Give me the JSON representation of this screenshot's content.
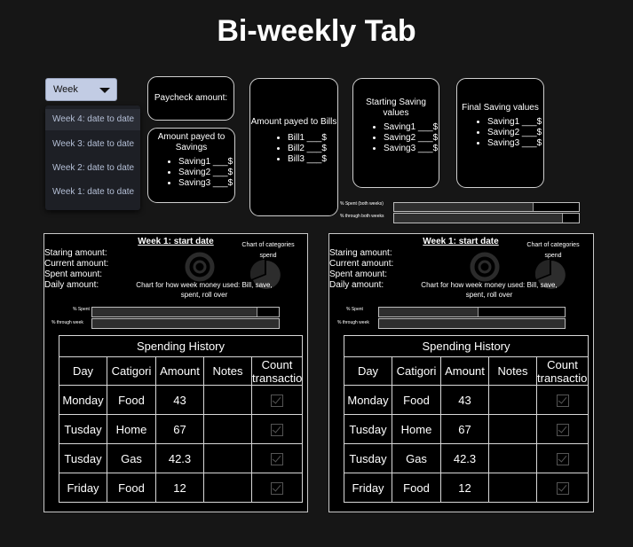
{
  "page": {
    "title": "Bi-weekly Tab"
  },
  "week_select": {
    "value": "Week",
    "options": [
      "Week 4: date to date",
      "Week 3: date to date",
      "Week 2: date to date",
      "Week 1: date to date"
    ]
  },
  "paycheck": {
    "label": "Paycheck amount:"
  },
  "savings_paid": {
    "label": "Amount payed to Savings",
    "items": [
      "Saving1 ___$",
      "Saving2 ___$",
      "Saving3 ___$"
    ]
  },
  "bills": {
    "label": "Amount payed to Bills",
    "items": [
      "Bill1 ___$",
      "Bill2 ___$",
      "Bill3 ___$"
    ]
  },
  "starting_saving": {
    "label": "Starting Saving values",
    "items": [
      "Saving1 ___$",
      "Saving2 ___$",
      "Saving3 ___$"
    ]
  },
  "final_saving": {
    "label": "Final Saving values",
    "items": [
      "Saving1 ___$",
      "Saving2 ___$",
      "Saving3 ___$"
    ]
  },
  "biweekly_bars": {
    "spent_label": "% Spent (both weeks)",
    "spent_fraction": 0.75,
    "through_label": "% through both weeks",
    "through_fraction": 0.91
  },
  "weeks": [
    {
      "title": "Week 1: start date",
      "labels": [
        "Staring amount:",
        "Current amount:",
        "Spent amount:",
        "Daily amount:"
      ],
      "categories_chart_label": "Chart of categories spend",
      "usage_chart_label": "Chart for how week money used: Bill, save, spent, roll over",
      "spent_label": "% Spent",
      "spent_fraction": 0.88,
      "through_label": "% through week",
      "through_fraction": 1.0,
      "history": {
        "title": "Spending History",
        "columns": [
          "Day",
          "Catigori",
          "Amount",
          "Notes",
          "Count transaction"
        ],
        "rows": [
          {
            "day": "Monday",
            "category": "Food",
            "amount": "43",
            "notes": ""
          },
          {
            "day": "Tusday",
            "category": "Home",
            "amount": "67",
            "notes": ""
          },
          {
            "day": "Tusday",
            "category": "Gas",
            "amount": "42.3",
            "notes": ""
          },
          {
            "day": "Friday",
            "category": "Food",
            "amount": "12",
            "notes": ""
          }
        ]
      }
    },
    {
      "title": "Week 1: start date",
      "labels": [
        "Staring amount:",
        "Current amount:",
        "Spent amount:",
        "Daily amount:"
      ],
      "categories_chart_label": "Chart of categories spend",
      "usage_chart_label": "Chart for how week money used: Bill, save, spent, roll over",
      "spent_label": "% Spent",
      "spent_fraction": 0.53,
      "through_label": "% through week",
      "through_fraction": 1.0,
      "history": {
        "title": "Spending History",
        "columns": [
          "Day",
          "Catigori",
          "Amount",
          "Notes",
          "Count transaction"
        ],
        "rows": [
          {
            "day": "Monday",
            "category": "Food",
            "amount": "43",
            "notes": ""
          },
          {
            "day": "Tusday",
            "category": "Home",
            "amount": "67",
            "notes": ""
          },
          {
            "day": "Tusday",
            "category": "Gas",
            "amount": "42.3",
            "notes": ""
          },
          {
            "day": "Friday",
            "category": "Food",
            "amount": "12",
            "notes": ""
          }
        ]
      }
    }
  ]
}
